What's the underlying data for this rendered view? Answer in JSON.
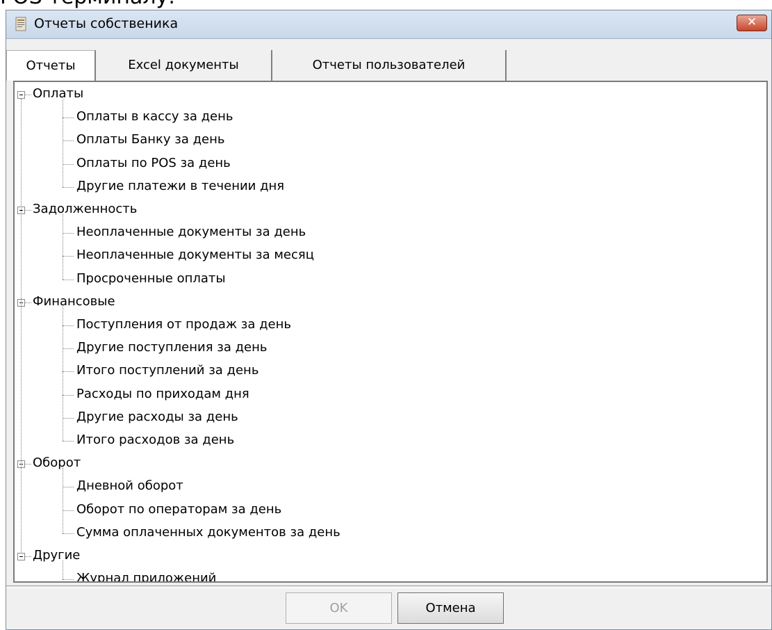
{
  "top_caption": "POS терминалу.",
  "window": {
    "title": "Отчеты собственика",
    "close_glyph": "✕"
  },
  "tabs": [
    {
      "label": "Отчеты",
      "active": true
    },
    {
      "label": "Excel документы",
      "active": false
    },
    {
      "label": "Отчеты  пользователей",
      "active": false
    }
  ],
  "tree": [
    {
      "label": "Оплаты",
      "children": [
        "Оплаты в кассу за день",
        "Оплаты Банку за день",
        "Оплаты по POS за день",
        "Другие платежи в течении дня"
      ]
    },
    {
      "label": "Задолженность",
      "children": [
        "Неоплаченные документы за день",
        "Неоплаченные документы за месяц",
        "Просроченные оплаты"
      ]
    },
    {
      "label": "Финансовые",
      "children": [
        "Поступления от продаж за день",
        "Другие поступления за день",
        "Итого поступлений за день",
        "Расходы по приходам дня",
        "Другие расходы за день",
        "Итого расходов за день"
      ]
    },
    {
      "label": "Оборот",
      "children": [
        "Дневной оборот",
        "Оборот по операторам за день",
        "Сумма  оплаченных документов за день"
      ]
    },
    {
      "label": "Другие",
      "children": [
        "Журнал приложений"
      ]
    }
  ],
  "buttons": {
    "ok": {
      "label": "OK",
      "enabled": false
    },
    "cancel": {
      "label": "Отмена",
      "enabled": true
    }
  }
}
